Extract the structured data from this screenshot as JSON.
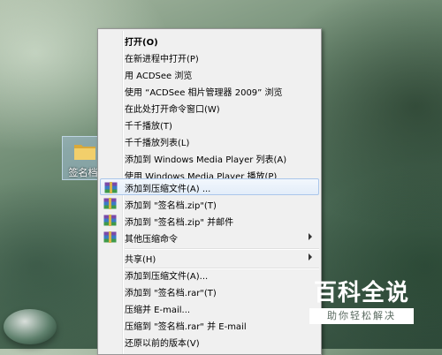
{
  "desktop": {
    "folder_label": "签名档"
  },
  "menu": {
    "items": [
      {
        "label": "打开(O)",
        "bold": true
      },
      {
        "label": "在新进程中打开(P)"
      },
      {
        "label": "用 ACDSee 浏览"
      },
      {
        "label": "使用 “ACDSee 相片管理器 2009” 浏览"
      },
      {
        "label": "在此处打开命令窗口(W)"
      },
      {
        "label": "千千播放(T)"
      },
      {
        "label": "千千播放列表(L)"
      },
      {
        "label": "添加到 Windows Media Player 列表(A)"
      },
      {
        "label": "使用 Windows Media Player 播放(P)"
      },
      {
        "label": "添加到压缩文件(A) ...",
        "icon": "winrar-icon",
        "highlighted": true
      },
      {
        "label": "添加到 \"签名档.zip\"(T)",
        "icon": "winrar-icon"
      },
      {
        "label": "添加到 \"签名档.zip\" 并邮件",
        "icon": "winrar-icon"
      },
      {
        "label": "其他压缩命令",
        "icon": "winrar-icon",
        "submenu": true
      },
      {
        "label": "共享(H)",
        "submenu": true
      },
      {
        "label": "添加到压缩文件(A)..."
      },
      {
        "label": "添加到 \"签名档.rar\"(T)"
      },
      {
        "label": "压缩并 E-mail..."
      },
      {
        "label": "压缩到 \"签名档.rar\" 并 E-mail"
      },
      {
        "label": "还原以前的版本(V)"
      }
    ]
  },
  "watermark": {
    "title": "百科全说",
    "subtitle": "助你轻松解决"
  },
  "colors": {
    "menu_bg": "#f0f0f0",
    "highlight_border": "#aac6ea",
    "folder": "#e8c15a"
  }
}
